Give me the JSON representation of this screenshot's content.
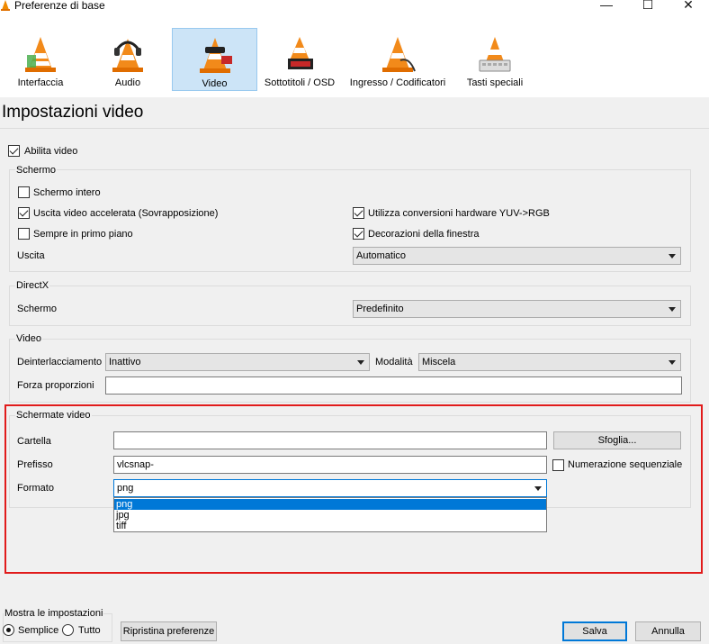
{
  "window": {
    "title": "Preferenze di base",
    "controls": [
      "—",
      "☐",
      "✕"
    ]
  },
  "categories": [
    {
      "label": "Interfaccia",
      "icon": "cone-interface-icon"
    },
    {
      "label": "Audio",
      "icon": "cone-headphones-icon"
    },
    {
      "label": "Video",
      "icon": "cone-glasses-icon",
      "selected": true
    },
    {
      "label": "Sottotitoli / OSD",
      "icon": "cone-subtitles-icon"
    },
    {
      "label": "Ingresso / Codificatori",
      "icon": "cone-cable-icon"
    },
    {
      "label": "Tasti speciali",
      "icon": "cone-keyboard-icon"
    }
  ],
  "page_title": "Impostazioni video",
  "enable_video": {
    "label": "Abilita video",
    "checked": true
  },
  "screen_group": {
    "title": "Schermo",
    "fullscreen": {
      "label": "Schermo intero",
      "checked": false
    },
    "overlay": {
      "label": "Uscita video accelerata (Sovrapposizione)",
      "checked": true
    },
    "always_on_top": {
      "label": "Sempre in primo piano",
      "checked": false
    },
    "hw_yuv": {
      "label": "Utilizza conversioni hardware YUV->RGB",
      "checked": true
    },
    "decorations": {
      "label": "Decorazioni della finestra",
      "checked": true
    },
    "output_label": "Uscita",
    "output_value": "Automatico"
  },
  "directx_group": {
    "title": "DirectX",
    "screen_label": "Schermo",
    "screen_value": "Predefinito"
  },
  "video_group": {
    "title": "Video",
    "deinterlace_label": "Deinterlacciamento",
    "deinterlace_value": "Inattivo",
    "mode_label": "Modalità",
    "mode_value": "Miscela",
    "aspect_label": "Forza proporzioni",
    "aspect_value": ""
  },
  "snapshots_group": {
    "title": "Schermate video",
    "folder_label": "Cartella",
    "folder_value": "",
    "browse_label": "Sfoglia...",
    "prefix_label": "Prefisso",
    "prefix_value": "vlcsnap-",
    "sequential": {
      "label": "Numerazione sequenziale",
      "checked": false
    },
    "format_label": "Formato",
    "format_value": "png",
    "format_options": [
      "png",
      "jpg",
      "tiff"
    ]
  },
  "footer": {
    "show_settings_label": "Mostra le impostazioni",
    "simple_label": "Semplice",
    "all_label": "Tutto",
    "simple_selected": true,
    "reset_label": "Ripristina preferenze",
    "save_label": "Salva",
    "cancel_label": "Annulla"
  },
  "colors": {
    "accent": "#0078d7",
    "highlight_box": "#e11b1b",
    "selected_tab": "#cce4f7"
  }
}
